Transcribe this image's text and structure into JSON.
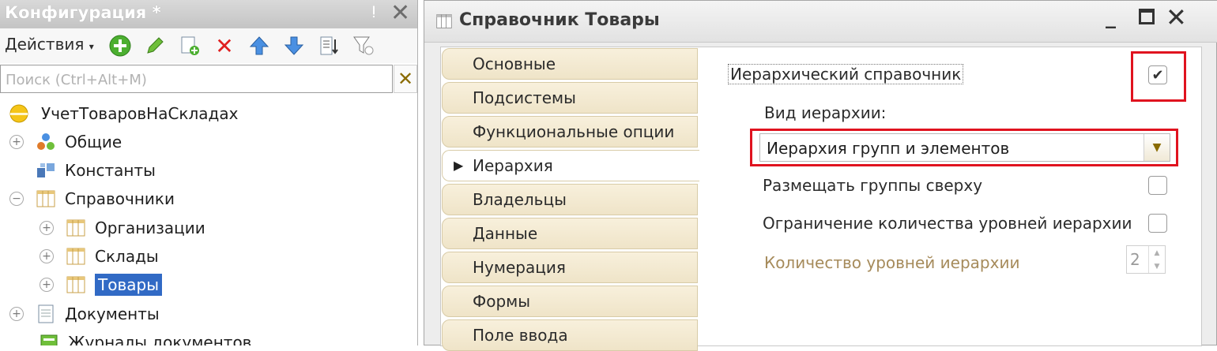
{
  "left_panel": {
    "title": "Конфигурация *",
    "pin_icon": "pin-icon",
    "actions_label": "Действия",
    "toolbar_icons": [
      "add-icon",
      "edit-pencil-icon",
      "copy-icon",
      "delete-icon",
      "move-up-icon",
      "move-down-icon",
      "sort-list-icon",
      "filter-icon"
    ],
    "search_placeholder": "Поиск (Ctrl+Alt+M)",
    "tree": [
      {
        "label": "УчетТоваровНаСкладах",
        "icon": "configuration-root-icon",
        "expander": ""
      },
      {
        "label": "Общие",
        "icon": "common-icon",
        "expander": "+"
      },
      {
        "label": "Константы",
        "icon": "constants-icon",
        "expander": ""
      },
      {
        "label": "Справочники",
        "icon": "catalogs-icon",
        "expander": "−"
      },
      {
        "label": "Организации",
        "icon": "catalog-icon",
        "expander": "+"
      },
      {
        "label": "Склады",
        "icon": "catalog-icon",
        "expander": "+"
      },
      {
        "label": "Товары",
        "icon": "catalog-icon",
        "expander": "+",
        "selected": true
      },
      {
        "label": "Документы",
        "icon": "documents-icon",
        "expander": "+"
      },
      {
        "label": "Журналы документов",
        "icon": "journals-icon",
        "expander": ""
      }
    ]
  },
  "window": {
    "title": "Справочник Товары",
    "tabs": [
      {
        "label": "Основные"
      },
      {
        "label": "Подсистемы"
      },
      {
        "label": "Функциональные опции"
      },
      {
        "label": "Иерархия",
        "active": true
      },
      {
        "label": "Владельцы"
      },
      {
        "label": "Данные"
      },
      {
        "label": "Нумерация"
      },
      {
        "label": "Формы"
      },
      {
        "label": "Поле ввода"
      }
    ],
    "hierarchy": {
      "hierarchical_label": "Иерархический справочник",
      "hierarchical_checked": true,
      "hierarchy_type_label": "Вид иерархии:",
      "hierarchy_type_value": "Иерархия групп и элементов",
      "groups_on_top_label": "Размещать группы сверху",
      "groups_on_top_checked": false,
      "limit_levels_label": "Ограничение количества уровней иерархии",
      "limit_levels_checked": false,
      "levels_count_label": "Количество уровней иерархии",
      "levels_count_value": "2"
    }
  },
  "colors": {
    "highlight_red": "#e0131f",
    "selection_blue": "#316ac5",
    "tab_beige": "#efe4c8"
  }
}
